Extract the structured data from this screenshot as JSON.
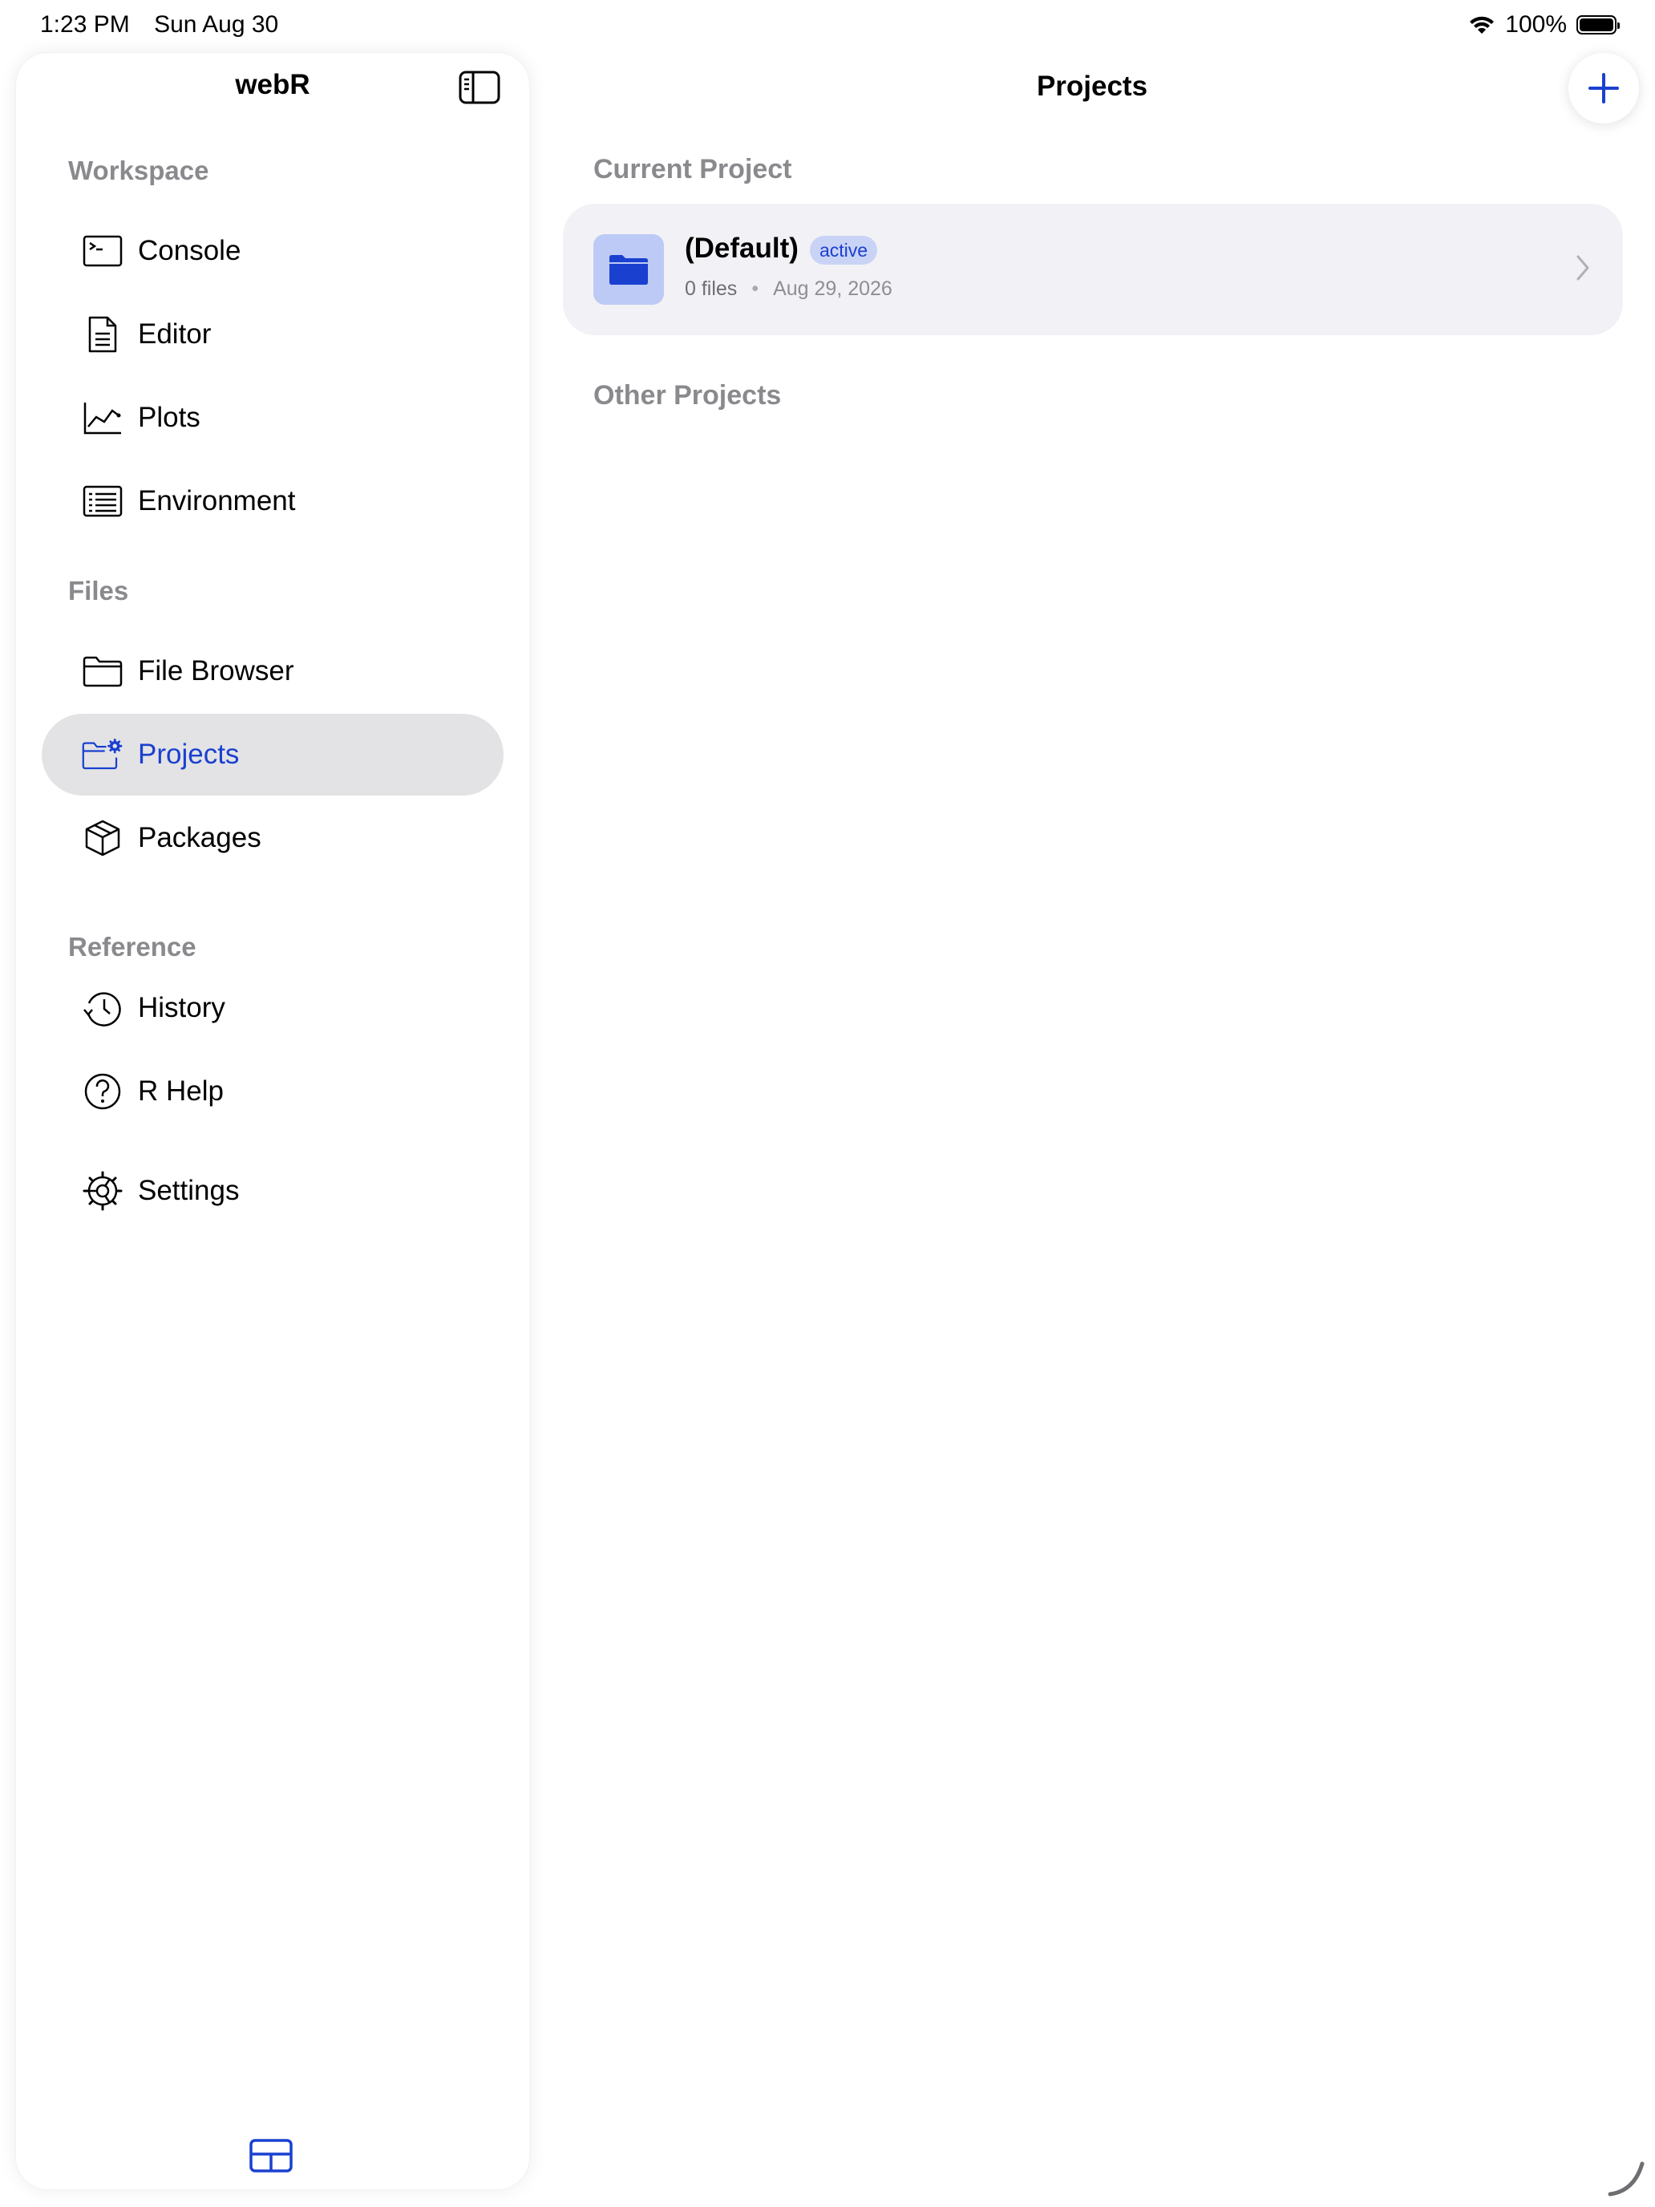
{
  "status_bar": {
    "time": "1:23 PM",
    "date": "Sun Aug 30",
    "battery": "100%"
  },
  "sidebar": {
    "title": "webR",
    "sections": {
      "workspace": "Workspace",
      "files": "Files",
      "reference": "Reference"
    },
    "items": {
      "console": "Console",
      "editor": "Editor",
      "plots": "Plots",
      "environment": "Environment",
      "file_browser": "File Browser",
      "projects": "Projects",
      "packages": "Packages",
      "history": "History",
      "r_help": "R Help",
      "settings": "Settings"
    },
    "selected": "projects"
  },
  "main": {
    "title": "Projects",
    "current_project_label": "Current Project",
    "other_projects_label": "Other Projects",
    "current_project": {
      "name": "(Default)",
      "badge": "active",
      "files": "0 files",
      "date": "Aug 29, 2026"
    }
  },
  "colors": {
    "accent": "#1a40d0",
    "selected_bg": "#e3e3e5",
    "card_bg": "#f2f2f6",
    "secondary_text": "#8a8a8e"
  }
}
